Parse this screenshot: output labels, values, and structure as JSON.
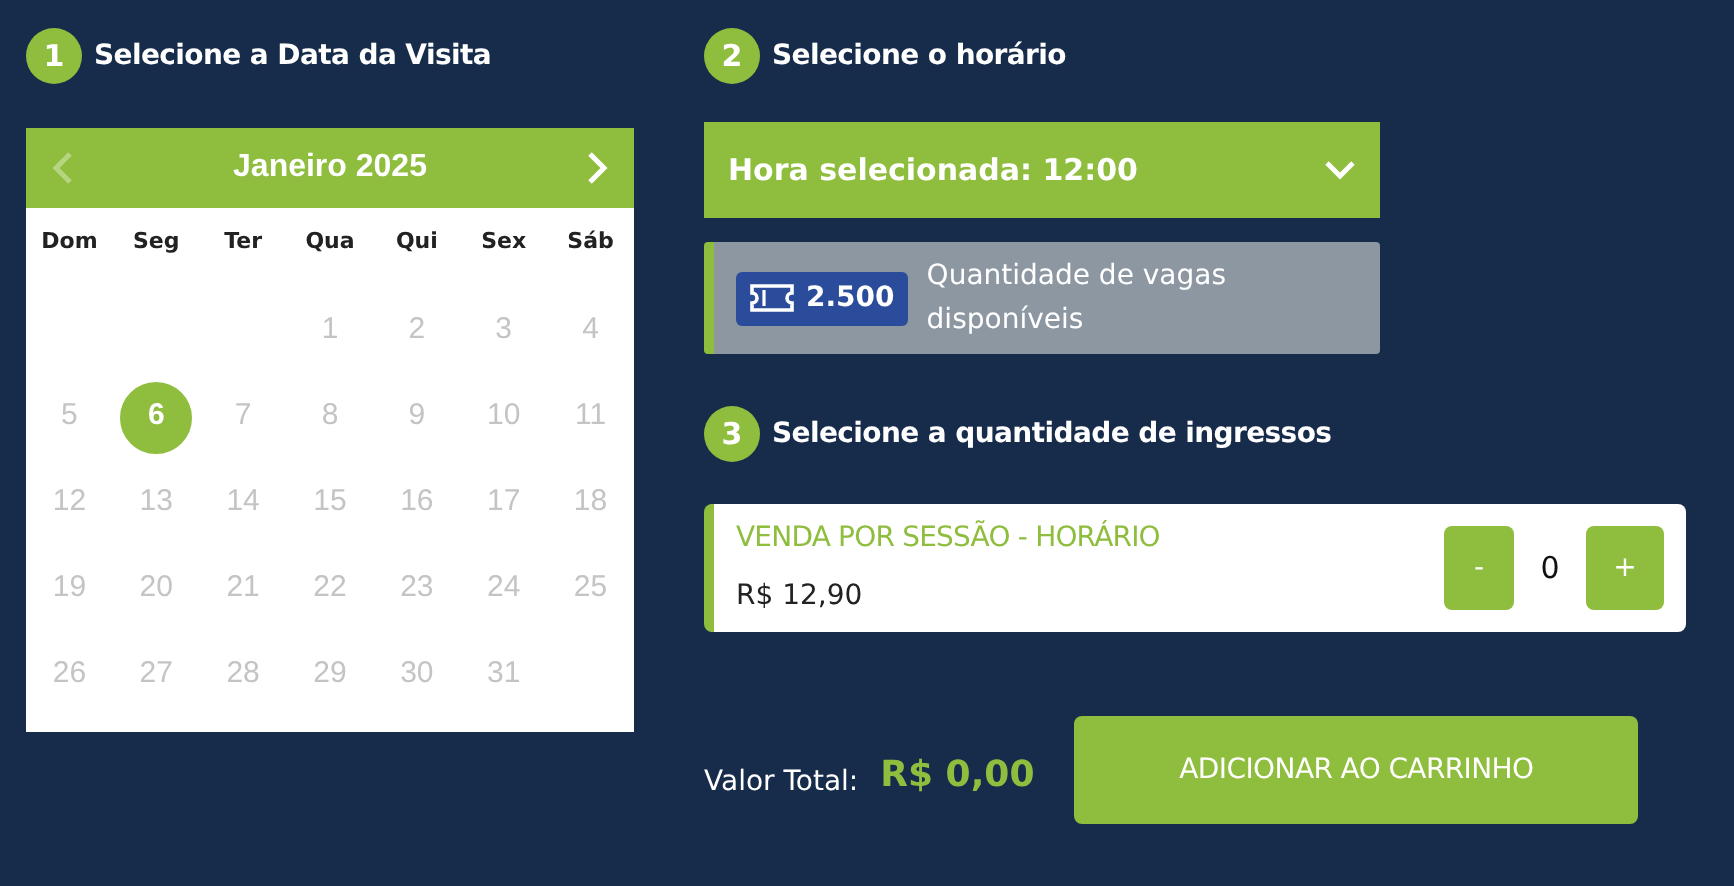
{
  "steps": [
    {
      "number": "1",
      "title": "Selecione a Data da Visita"
    },
    {
      "number": "2",
      "title": "Selecione o horário"
    },
    {
      "number": "3",
      "title": "Selecione a quantidade de ingressos"
    }
  ],
  "calendar": {
    "month": "Janeiro 2025",
    "prev_disabled": true,
    "next_disabled": false,
    "weekdays": [
      "Dom",
      "Seg",
      "Ter",
      "Qua",
      "Qui",
      "Sex",
      "Sáb"
    ],
    "weeks": [
      [
        {
          "kind": "blank"
        },
        {
          "kind": "blank"
        },
        {
          "kind": "blank"
        },
        {
          "kind": "day",
          "day": "1",
          "selected": false,
          "disabled": true
        },
        {
          "kind": "day",
          "day": "2",
          "selected": false,
          "disabled": true
        },
        {
          "kind": "day",
          "day": "3",
          "selected": false,
          "disabled": true
        },
        {
          "kind": "day",
          "day": "4",
          "selected": false,
          "disabled": true
        }
      ],
      [
        {
          "kind": "day",
          "day": "5",
          "selected": false,
          "disabled": true
        },
        {
          "kind": "day",
          "day": "6",
          "selected": true,
          "disabled": false
        },
        {
          "kind": "day",
          "day": "7",
          "selected": false,
          "disabled": true
        },
        {
          "kind": "day",
          "day": "8",
          "selected": false,
          "disabled": true
        },
        {
          "kind": "day",
          "day": "9",
          "selected": false,
          "disabled": true
        },
        {
          "kind": "day",
          "day": "10",
          "selected": false,
          "disabled": true
        },
        {
          "kind": "day",
          "day": "11",
          "selected": false,
          "disabled": true
        }
      ],
      [
        {
          "kind": "day",
          "day": "12",
          "selected": false,
          "disabled": true
        },
        {
          "kind": "day",
          "day": "13",
          "selected": false,
          "disabled": true
        },
        {
          "kind": "day",
          "day": "14",
          "selected": false,
          "disabled": true
        },
        {
          "kind": "day",
          "day": "15",
          "selected": false,
          "disabled": true
        },
        {
          "kind": "day",
          "day": "16",
          "selected": false,
          "disabled": true
        },
        {
          "kind": "day",
          "day": "17",
          "selected": false,
          "disabled": true
        },
        {
          "kind": "day",
          "day": "18",
          "selected": false,
          "disabled": true
        }
      ],
      [
        {
          "kind": "day",
          "day": "19",
          "selected": false,
          "disabled": true
        },
        {
          "kind": "day",
          "day": "20",
          "selected": false,
          "disabled": true
        },
        {
          "kind": "day",
          "day": "21",
          "selected": false,
          "disabled": true
        },
        {
          "kind": "day",
          "day": "22",
          "selected": false,
          "disabled": true
        },
        {
          "kind": "day",
          "day": "23",
          "selected": false,
          "disabled": true
        },
        {
          "kind": "day",
          "day": "24",
          "selected": false,
          "disabled": true
        },
        {
          "kind": "day",
          "day": "25",
          "selected": false,
          "disabled": true
        }
      ],
      [
        {
          "kind": "day",
          "day": "26",
          "selected": false,
          "disabled": true
        },
        {
          "kind": "day",
          "day": "27",
          "selected": false,
          "disabled": true
        },
        {
          "kind": "day",
          "day": "28",
          "selected": false,
          "disabled": true
        },
        {
          "kind": "day",
          "day": "29",
          "selected": false,
          "disabled": true
        },
        {
          "kind": "day",
          "day": "30",
          "selected": false,
          "disabled": true
        },
        {
          "kind": "day",
          "day": "31",
          "selected": false,
          "disabled": true
        },
        {
          "kind": "blank"
        }
      ]
    ]
  },
  "time_select": {
    "label": "Hora selecionada: 12:00"
  },
  "availability": {
    "count": "2.500",
    "label": "Quantidade de vagas disponíveis"
  },
  "ticket": {
    "name": "VENDA POR SESSÃO - HORÁRIO",
    "price": "R$ 12,90",
    "decrement": "-",
    "quantity": "0",
    "increment": "+"
  },
  "total": {
    "label": "Valor Total:",
    "value": "R$ 0,00"
  },
  "add_to_cart": "ADICIONAR AO CARRINHO"
}
